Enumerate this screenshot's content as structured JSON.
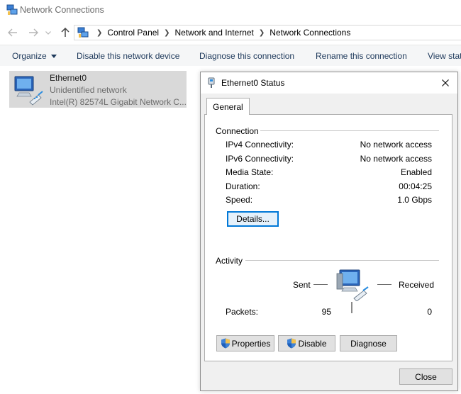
{
  "window": {
    "title": "Network Connections",
    "title_icon": "network-connections-icon"
  },
  "address": {
    "crumbs": [
      "Control Panel",
      "Network and Internet",
      "Network Connections"
    ]
  },
  "commands": [
    {
      "label": "Organize",
      "has_dropdown": true
    },
    {
      "label": "Disable this network device"
    },
    {
      "label": "Diagnose this connection"
    },
    {
      "label": "Rename this connection"
    },
    {
      "label": "View stat"
    }
  ],
  "adapter": {
    "name": "Ethernet0",
    "status": "Unidentified network",
    "device": "Intel(R) 82574L Gigabit Network C..."
  },
  "dialog": {
    "title": "Ethernet0 Status",
    "tab": "General",
    "connection_group": "Connection",
    "rows": [
      {
        "label": "IPv4 Connectivity:",
        "value": "No network access"
      },
      {
        "label": "IPv6 Connectivity:",
        "value": "No network access"
      },
      {
        "label": "Media State:",
        "value": "Enabled"
      },
      {
        "label": "Duration:",
        "value": "00:04:25"
      },
      {
        "label": "Speed:",
        "value": "1.0 Gbps"
      }
    ],
    "details_button": "Details...",
    "activity_group": "Activity",
    "sent_label": "Sent",
    "received_label": "Received",
    "packets_label": "Packets:",
    "packets_sent": "95",
    "packets_received": "0",
    "properties_button": "Properties",
    "disable_button": "Disable",
    "diagnose_button": "Diagnose",
    "close_button": "Close"
  },
  "colors": {
    "accent": "#0078d7",
    "command_text": "#1e395b",
    "selected_tile": "#d9d9d9",
    "dialog_bg": "#f0f0f0"
  }
}
